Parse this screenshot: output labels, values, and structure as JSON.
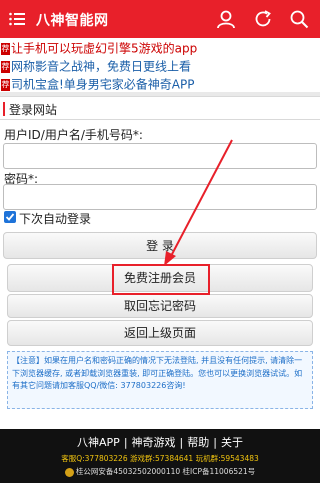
{
  "header": {
    "title": "八神智能网",
    "icons": [
      "menu-icon",
      "user-icon",
      "refresh-icon",
      "search-icon"
    ]
  },
  "ads": [
    {
      "tag": "荐",
      "text": "让手机可以玩虚幻引擎5游戏的app",
      "color": "#cc0000"
    },
    {
      "tag": "荐",
      "text": "网称影音之战神，免费日更线上看",
      "color": "#1a5ea8"
    },
    {
      "tag": "荐",
      "text": "司机宝盒!单身男宅家必备神奇APP",
      "color": "#1a5ea8"
    }
  ],
  "login": {
    "section_title": "登录网站",
    "username_label": "用户ID/用户名/手机号码*:",
    "username_value": "",
    "password_label": "密码*:",
    "password_value": "",
    "remember_label": "下次自动登录",
    "remember_checked": true,
    "login_button": "登 录",
    "register_button": "免费注册会员",
    "recover_button": "取回忘记密码",
    "back_button": "返回上级页面"
  },
  "notice": {
    "text": "【注意】如果在用户名和密码正确的情况下无法登陆, 并且没有任何提示, 请清除一下浏览器缓存, 或者卸载浏览器重装, 即可正确登陆。您也可以更换浏览器试试。如有其它问题请加客服QQ/微信: 377803226咨询!"
  },
  "footer": {
    "nav": [
      "八神APP",
      "神奇游戏",
      "帮助",
      "关于"
    ],
    "separator": "|",
    "qq_line": "客服Q:377803226 游戏群:57384641 玩机群:59543483",
    "beian": "桂公网安备45032502000110 桂ICP备11006521号"
  },
  "colors": {
    "brand_red": "#e8202a",
    "notice_blue": "#1e6fc8",
    "checkbox_blue": "#1e73d9",
    "footer_bg": "#111111"
  }
}
